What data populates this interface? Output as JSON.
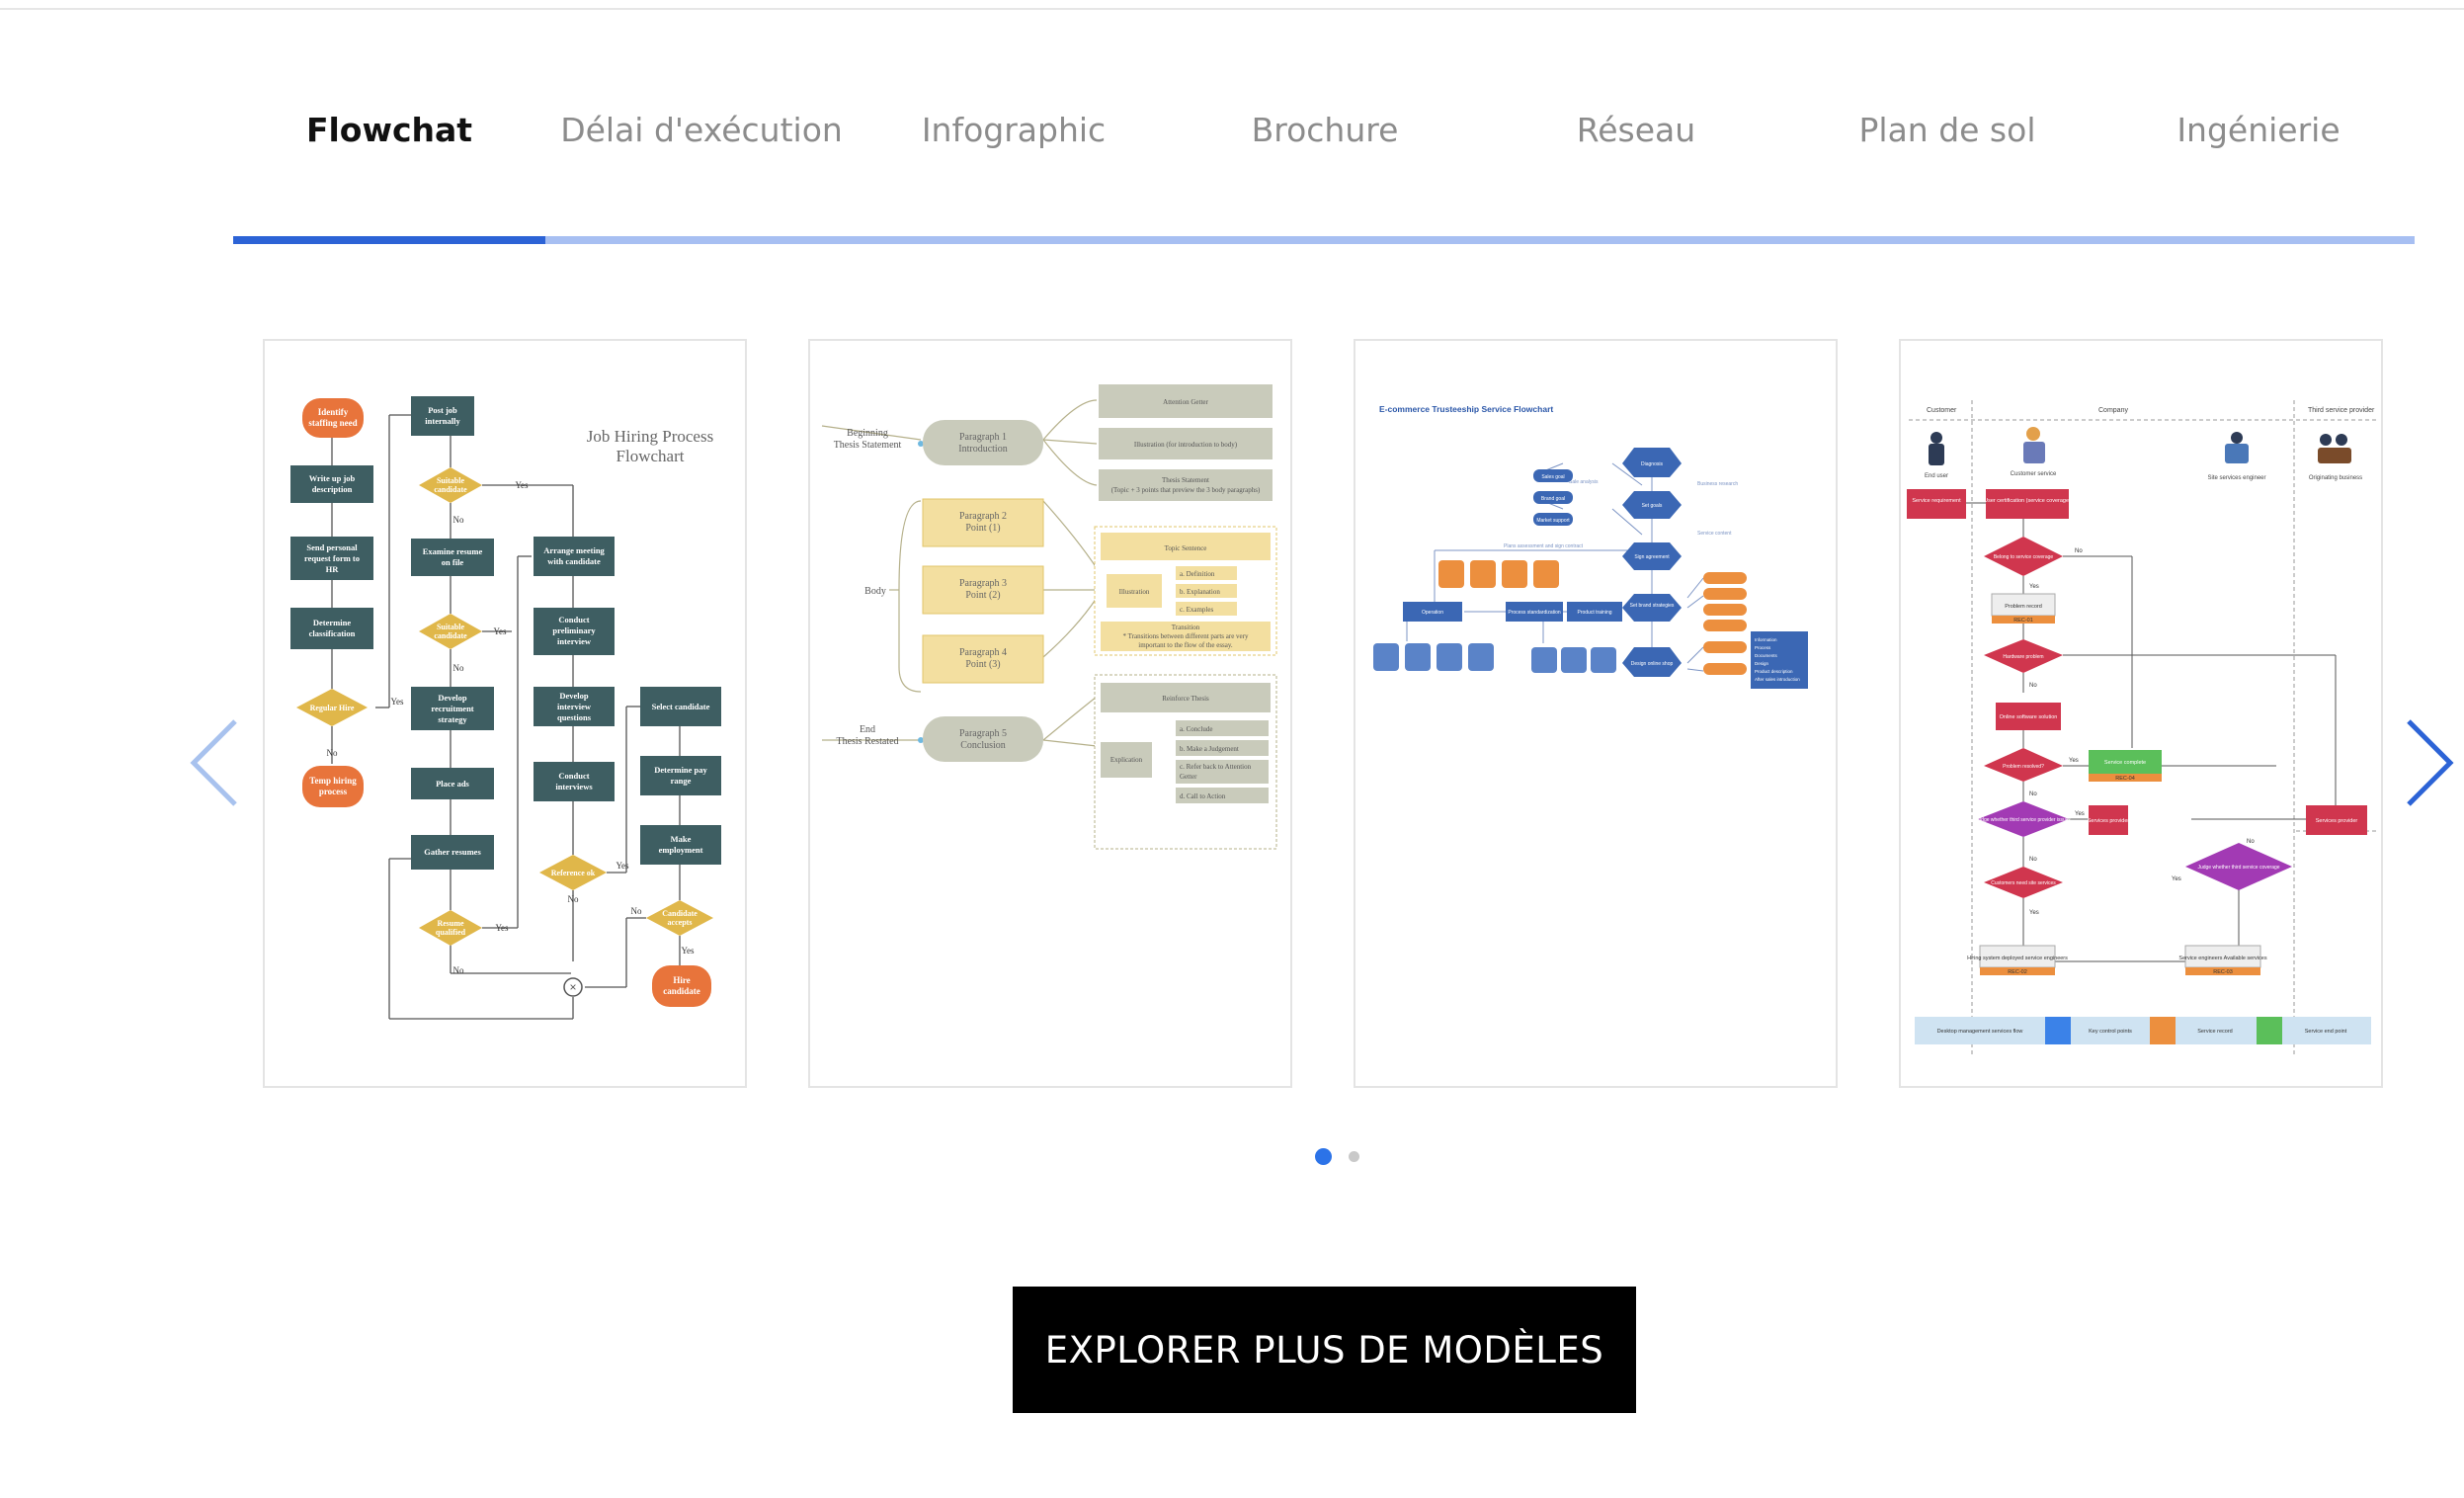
{
  "tabs": [
    {
      "label": "Flowchat",
      "active": true
    },
    {
      "label": "Délai d'exécution",
      "active": false
    },
    {
      "label": "Infographic",
      "active": false
    },
    {
      "label": "Brochure",
      "active": false
    },
    {
      "label": "Réseau",
      "active": false
    },
    {
      "label": "Plan de sol",
      "active": false
    },
    {
      "label": "Ingénierie",
      "active": false
    }
  ],
  "carousel": {
    "prev_icon": "chevron-left-icon",
    "next_icon": "chevron-right-icon",
    "page_count": 2,
    "current_page": 1
  },
  "templates": {
    "job_hiring": {
      "title_line1": "Job Hiring Process",
      "title_line2": "Flowchart",
      "start": [
        "Identify",
        "staffing need"
      ],
      "left_col": [
        [
          "Write up job",
          "description"
        ],
        [
          "Send personal",
          "request form to",
          "HR"
        ],
        [
          "Determine",
          "classification"
        ]
      ],
      "regular_hire": "Regular Hire",
      "temp_hiring": [
        "Temp hiring",
        "process"
      ],
      "col2": [
        [
          "Post job",
          "internally"
        ],
        [
          "Examine resume",
          "on file"
        ],
        [
          "Develop",
          "recruitment",
          "strategy"
        ],
        [
          "Place ads"
        ],
        [
          "Gather resumes"
        ]
      ],
      "suitable1": [
        "Suitable",
        "candidate"
      ],
      "suitable2": [
        "Suitable",
        "candidate"
      ],
      "resume_qualified": [
        "Resume",
        "qualified"
      ],
      "col3": [
        [
          "Arrange meeting",
          "with candidate"
        ],
        [
          "Conduct",
          "preliminary",
          "interview"
        ],
        [
          "Develop",
          "interview",
          "questions"
        ],
        [
          "Conduct",
          "interviews"
        ]
      ],
      "reference": "Reference ok",
      "col4": [
        [
          "Select candidate"
        ],
        [
          "Determine pay",
          "range"
        ],
        [
          "Make",
          "employment"
        ]
      ],
      "candidate_accepts": [
        "Candidate",
        "accepts"
      ],
      "hire": [
        "Hire",
        "candidate"
      ],
      "yes": "Yes",
      "no": "No"
    },
    "essay": {
      "beginning": [
        "Beginning",
        "Thesis Statement"
      ],
      "body": "Body",
      "end": [
        "End",
        "Thesis Restated"
      ],
      "p1": [
        "Paragraph 1",
        "Introduction"
      ],
      "p2": [
        "Paragraph 2",
        "Point (1)"
      ],
      "p3": [
        "Paragraph 3",
        "Point (2)"
      ],
      "p4": [
        "Paragraph 4",
        "Point (3)"
      ],
      "p5": [
        "Paragraph 5",
        "Conclusion"
      ],
      "attention": "Attention Getter",
      "illustration_intro": "Illustration (for introduction to body)",
      "thesis_statement": [
        "Thesis Statement",
        "(Topic + 3 points that preview the 3 body paragraphs)"
      ],
      "topic_sentence": "Topic Sentence",
      "illustration": "Illustration",
      "defs": [
        "a. Definition",
        "b. Explanation",
        "c. Examples"
      ],
      "transition": [
        "Transition",
        "* Transitions between different parts are very",
        "important to the flow of the essay."
      ],
      "reinforce": "Reinforce Thesis",
      "explication": "Explication",
      "concl": [
        "a. Conclude",
        "b. Make a Judgement",
        "c. Refer back to Attention",
        "Getter",
        "d. Call to Action"
      ]
    },
    "ecommerce": {
      "title": "E-commerce Trusteeship Service Flowchart",
      "nodes": [
        "Sales goal",
        "Brand goal",
        "Market support",
        "Diagnosis",
        "Set goals",
        "Sign agreement",
        "Set brand strategies",
        "Design online shop",
        "Operation",
        "Process standardization",
        "Product training"
      ],
      "annotations": [
        "Sale analysis",
        "Business research",
        "Service content",
        "Plans assessment and sign contract"
      ],
      "right_list": [
        "Information",
        "Process",
        "Documents",
        "Design",
        "Product description",
        "After sales introduction"
      ]
    },
    "swimlane": {
      "lanes": [
        "Customer",
        "Company",
        "Third service provider"
      ],
      "roles": [
        "End user",
        "Customer service",
        "Site services engineer",
        "Originating business"
      ],
      "boxes": [
        "Service requirement",
        "User certification (service coverage)",
        "Problem record",
        "REC-01",
        "Online software solution",
        "Service complete",
        "REC-04",
        "Services provider",
        "Services provider",
        "Hiring system deployed service engineers",
        "REC-02",
        "Service engineers Available services",
        "REC-03"
      ],
      "diamonds": [
        "Belong to service coverage",
        "Hardware problem",
        "Problem resolved?",
        "Judge whether third service provider issues",
        "Customers need site services",
        "Judge whether third service coverage"
      ],
      "legend": [
        "Desktop management services flow",
        "Key control points",
        "Service record",
        "Service end point"
      ],
      "yes": "Yes",
      "no": "No"
    }
  },
  "cta_label": "EXPLORER PLUS DE MODÈLES",
  "colors": {
    "accent": "#2c63d6",
    "track": "#a7bff2",
    "flow_box": "#3e5e62",
    "flow_decision": "#e0b74a",
    "flow_terminal": "#e8743b",
    "essay_gold": "#f3dfa0",
    "essay_gray": "#c9cbbb",
    "ecom_blue": "#3b67b4",
    "ecom_orange": "#ec8f3e",
    "lane_red": "#d0364e",
    "lane_purple": "#a23ab4"
  }
}
